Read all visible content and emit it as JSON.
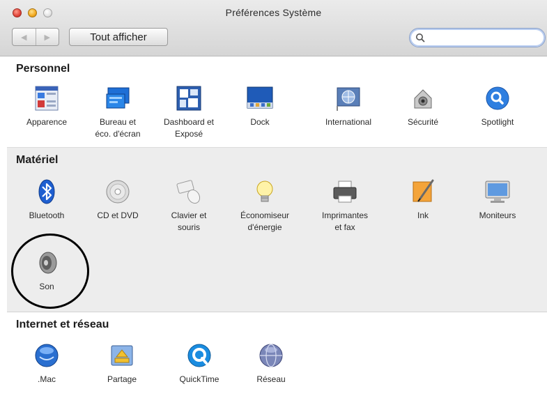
{
  "window": {
    "title": "Préférences Système"
  },
  "toolbar": {
    "back_glyph": "◀",
    "forward_glyph": "▶",
    "show_all_label": "Tout afficher",
    "search_value": "",
    "search_placeholder": ""
  },
  "sections": {
    "personal": {
      "title": "Personnel",
      "items": [
        {
          "label": "Apparence",
          "icon": "appearance-icon"
        },
        {
          "label": "Bureau et\néco. d'écran",
          "icon": "desktop-screensaver-icon"
        },
        {
          "label": "Dashboard et\nExposé",
          "icon": "dashboard-expose-icon"
        },
        {
          "label": "Dock",
          "icon": "dock-icon"
        },
        {
          "label": "International",
          "icon": "international-icon"
        },
        {
          "label": "Sécurité",
          "icon": "security-icon"
        },
        {
          "label": "Spotlight",
          "icon": "spotlight-icon"
        }
      ]
    },
    "hardware": {
      "title": "Matériel",
      "items": [
        {
          "label": "Bluetooth",
          "icon": "bluetooth-icon"
        },
        {
          "label": "CD et DVD",
          "icon": "cd-dvd-icon"
        },
        {
          "label": "Clavier et\nsouris",
          "icon": "keyboard-mouse-icon"
        },
        {
          "label": "Économiseur\nd'énergie",
          "icon": "energy-saver-icon"
        },
        {
          "label": "Imprimantes\net fax",
          "icon": "printer-fax-icon"
        },
        {
          "label": "Ink",
          "icon": "ink-icon"
        },
        {
          "label": "Moniteurs",
          "icon": "displays-icon"
        },
        {
          "label": "Son",
          "icon": "sound-icon"
        }
      ]
    },
    "internet": {
      "title": "Internet et réseau",
      "items": [
        {
          "label": ".Mac",
          "icon": "dotmac-icon"
        },
        {
          "label": "Partage",
          "icon": "sharing-icon"
        },
        {
          "label": "QuickTime",
          "icon": "quicktime-icon"
        },
        {
          "label": "Réseau",
          "icon": "network-icon"
        }
      ]
    }
  },
  "colors": {
    "hardware_bg": "#ededed",
    "spotlight_blue": "#2f7fe0",
    "bluetooth_blue": "#1f5fd0"
  }
}
